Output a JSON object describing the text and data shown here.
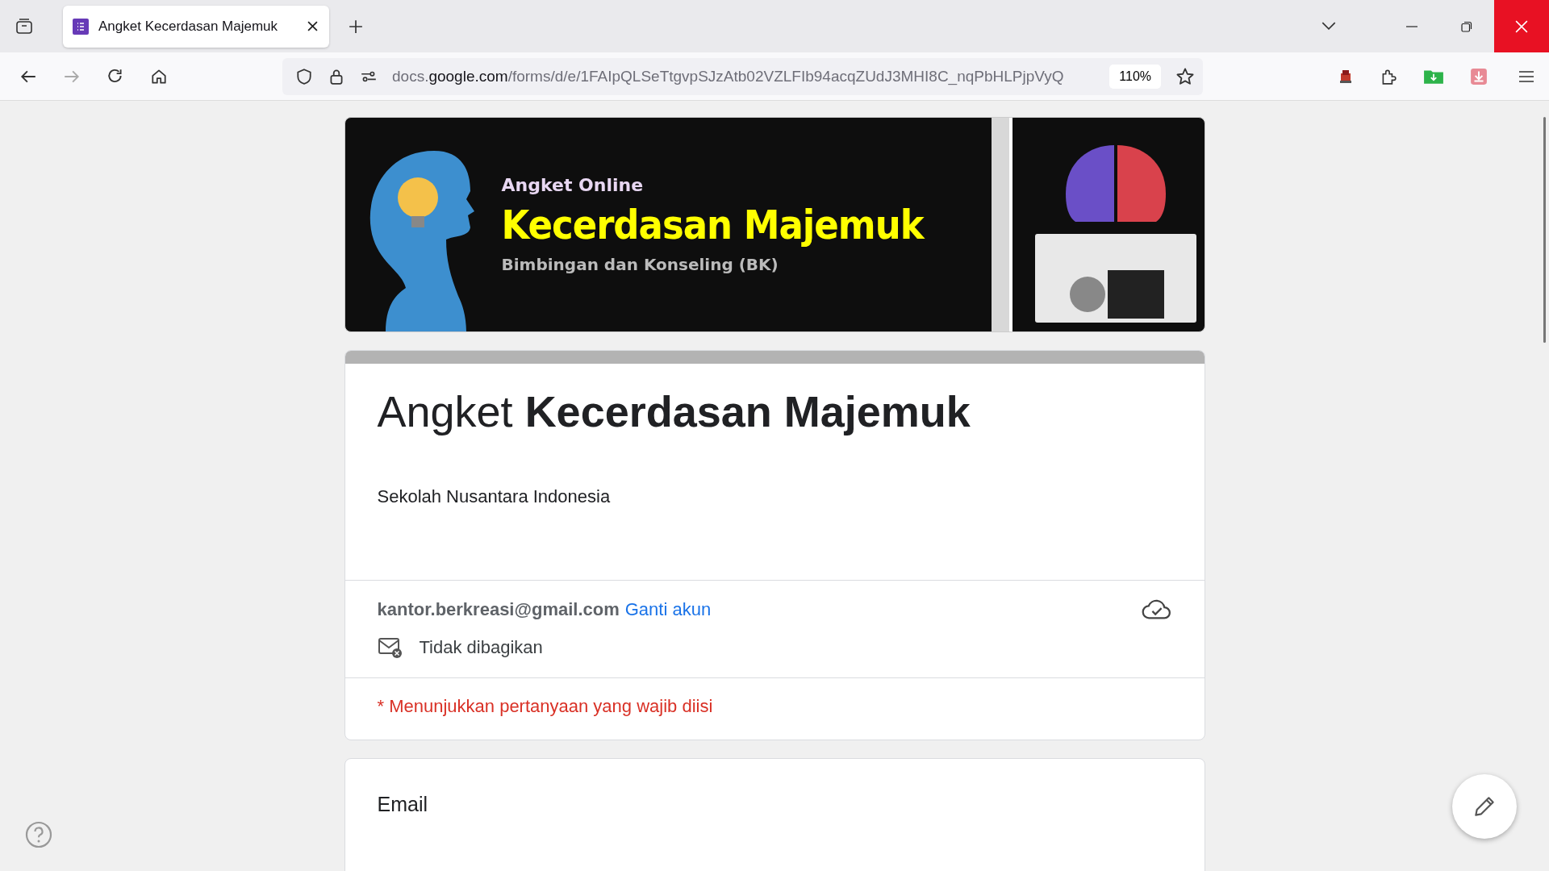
{
  "tabs": [
    {
      "title": "Angket Kecerdasan Majemuk",
      "selected": true
    }
  ],
  "toolbar": {
    "url_domain_prefix": "docs.",
    "url_domain": "google.com",
    "url_path": "/forms/d/e/1FAIpQLSeTtgvpSJzAtb02VZLFIb94acqZUdJ3MHI8C_nqPbHLPjpVyQ",
    "zoom": "110%"
  },
  "banner": {
    "subtitle": "Angket Online",
    "heading": "Kecerdasan Majemuk",
    "caption": "Bimbingan dan Konseling (BK)"
  },
  "form": {
    "title_plain": "Angket",
    "title_bold": "Kecerdasan Majemuk",
    "description": "Sekolah Nusantara Indonesia",
    "account": "kantor.berkreasi@gmail.com",
    "switch_account": "Ganti akun",
    "sharing": "Tidak dibagikan",
    "required_note": "* Menunjukkan pertanyaan yang wajib diisi"
  },
  "questions": [
    {
      "label": "Email"
    }
  ]
}
